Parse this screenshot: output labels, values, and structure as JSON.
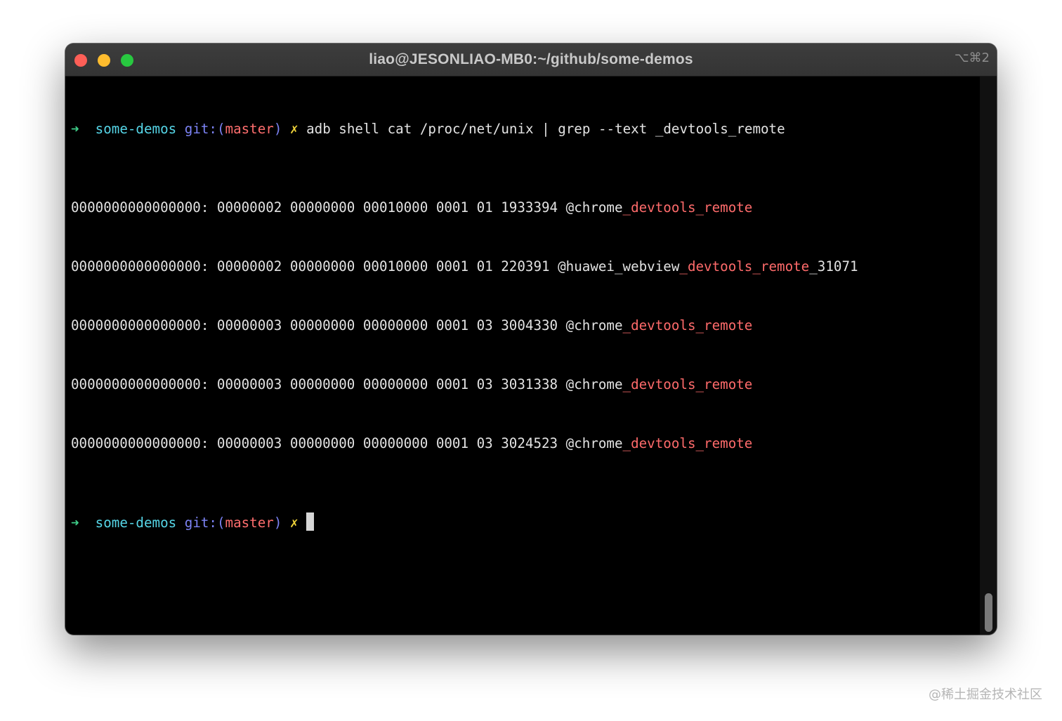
{
  "window": {
    "title": "liao@JESONLIAO-MB0:~/github/some-demos",
    "shortcut": "⌥⌘2"
  },
  "colors": {
    "prompt_arrow": "#3fcf8a",
    "directory": "#56d6e8",
    "git_label": "#7c83f5",
    "branch": "#ff6e6e",
    "dirty_mark": "#f0d43a",
    "grep_highlight": "#ff6b6b"
  },
  "prompt": {
    "arrow": "➜",
    "dir": "some-demos",
    "git_prefix": "git:(",
    "branch": "master",
    "git_suffix": ")",
    "dirty": "✗"
  },
  "command": "adb shell cat /proc/net/unix | grep --text _devtools_remote",
  "output": [
    {
      "pre": "0000000000000000: 00000002 00000000 00010000 0001 01 1933394 @chrome",
      "match": "_devtools_remote",
      "post": ""
    },
    {
      "pre": "0000000000000000: 00000002 00000000 00010000 0001 01 220391 @huawei_webview",
      "match": "_devtools_remote",
      "post": "_31071"
    },
    {
      "pre": "0000000000000000: 00000003 00000000 00000000 0001 03 3004330 @chrome",
      "match": "_devtools_remote",
      "post": ""
    },
    {
      "pre": "0000000000000000: 00000003 00000000 00000000 0001 03 3031338 @chrome",
      "match": "_devtools_remote",
      "post": ""
    },
    {
      "pre": "0000000000000000: 00000003 00000000 00000000 0001 03 3024523 @chrome",
      "match": "_devtools_remote",
      "post": ""
    }
  ],
  "watermark": "@稀土掘金技术社区"
}
